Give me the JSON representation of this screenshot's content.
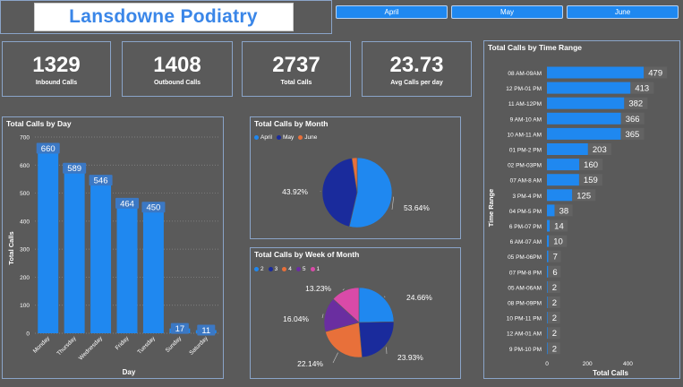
{
  "header": {
    "title": "Lansdowne Podiatry"
  },
  "slicers": [
    {
      "label": "April"
    },
    {
      "label": "May"
    },
    {
      "label": "June"
    }
  ],
  "kpis": [
    {
      "value": "1329",
      "label": "Inbound Calls"
    },
    {
      "value": "1408",
      "label": "Outbound Calls"
    },
    {
      "value": "2737",
      "label": "Total Calls"
    },
    {
      "value": "23.73",
      "label": "Avg Calls per day"
    }
  ],
  "colors": {
    "blue": "#1f88f0",
    "navy": "#1a2b9c",
    "orange": "#e8703a",
    "purple": "#6a2ea0",
    "pink": "#d94aa8",
    "panel_border": "#8aa4c8"
  },
  "chart_data": [
    {
      "type": "bar",
      "title": "Total Calls by Day",
      "xlabel": "Day",
      "ylabel": "Total Calls",
      "categories": [
        "Monday",
        "Thursday",
        "Wednesday",
        "Friday",
        "Tuesday",
        "Sunday",
        "Saturday"
      ],
      "values": [
        660,
        589,
        546,
        464,
        450,
        17,
        11
      ],
      "ylim": [
        0,
        700
      ],
      "yticks": [
        0,
        100,
        200,
        300,
        400,
        500,
        600,
        700
      ],
      "grid": true
    },
    {
      "type": "pie",
      "title": "Total Calls by Month",
      "legend": [
        "April",
        "May",
        "June"
      ],
      "values": [
        53.64,
        43.92,
        2.44
      ],
      "labels": [
        "53.64%",
        "43.92%",
        ""
      ],
      "slice_colors": [
        "#1f88f0",
        "#1a2b9c",
        "#e8703a"
      ],
      "legend_position": "top-left"
    },
    {
      "type": "pie",
      "title": "Total Calls by Week of Month",
      "legend": [
        "2",
        "3",
        "4",
        "5",
        "1"
      ],
      "values": [
        24.66,
        23.93,
        22.14,
        16.04,
        13.23
      ],
      "labels": [
        "24.66%",
        "23.93%",
        "22.14%",
        "16.04%",
        "13.23%"
      ],
      "slice_colors": [
        "#1f88f0",
        "#1a2b9c",
        "#e8703a",
        "#6a2ea0",
        "#d94aa8"
      ],
      "legend_position": "top-left"
    },
    {
      "type": "bar",
      "orientation": "horizontal",
      "title": "Total Calls by Time Range",
      "xlabel": "Total Calls",
      "ylabel": "Time Range",
      "categories": [
        "08 AM-09AM",
        "12 PM-01 PM",
        "11 AM-12PM",
        "9 AM-10 AM",
        "10 AM-11 AM",
        "01 PM-2 PM",
        "02 PM-03PM",
        "07 AM-8 AM",
        "3 PM-4 PM",
        "04 PM-5 PM",
        "6 PM-07 PM",
        "6 AM-07 AM",
        "05 PM-06PM",
        "07 PM-8 PM",
        "05 AM-06AM",
        "08 PM-09PM",
        "10 PM-11 PM",
        "12 AM-01 AM",
        "9 PM-10 PM"
      ],
      "values": [
        479,
        413,
        382,
        366,
        365,
        203,
        160,
        159,
        125,
        38,
        14,
        10,
        7,
        6,
        2,
        2,
        2,
        2,
        2
      ],
      "xlim": [
        0,
        500
      ],
      "xticks": [
        0,
        200,
        400
      ]
    }
  ]
}
